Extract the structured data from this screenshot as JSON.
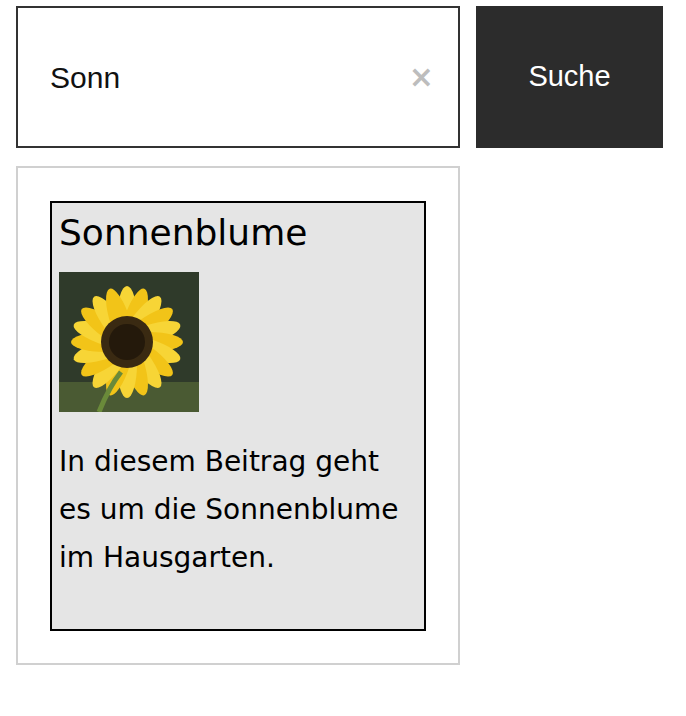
{
  "search": {
    "value": "Sonn",
    "clear": "×",
    "button": "Suche"
  },
  "results": [
    {
      "title": "Sonnenblume",
      "text": "In diesem Beitrag geht es um die Sonnenblume im Hausgarten."
    }
  ]
}
